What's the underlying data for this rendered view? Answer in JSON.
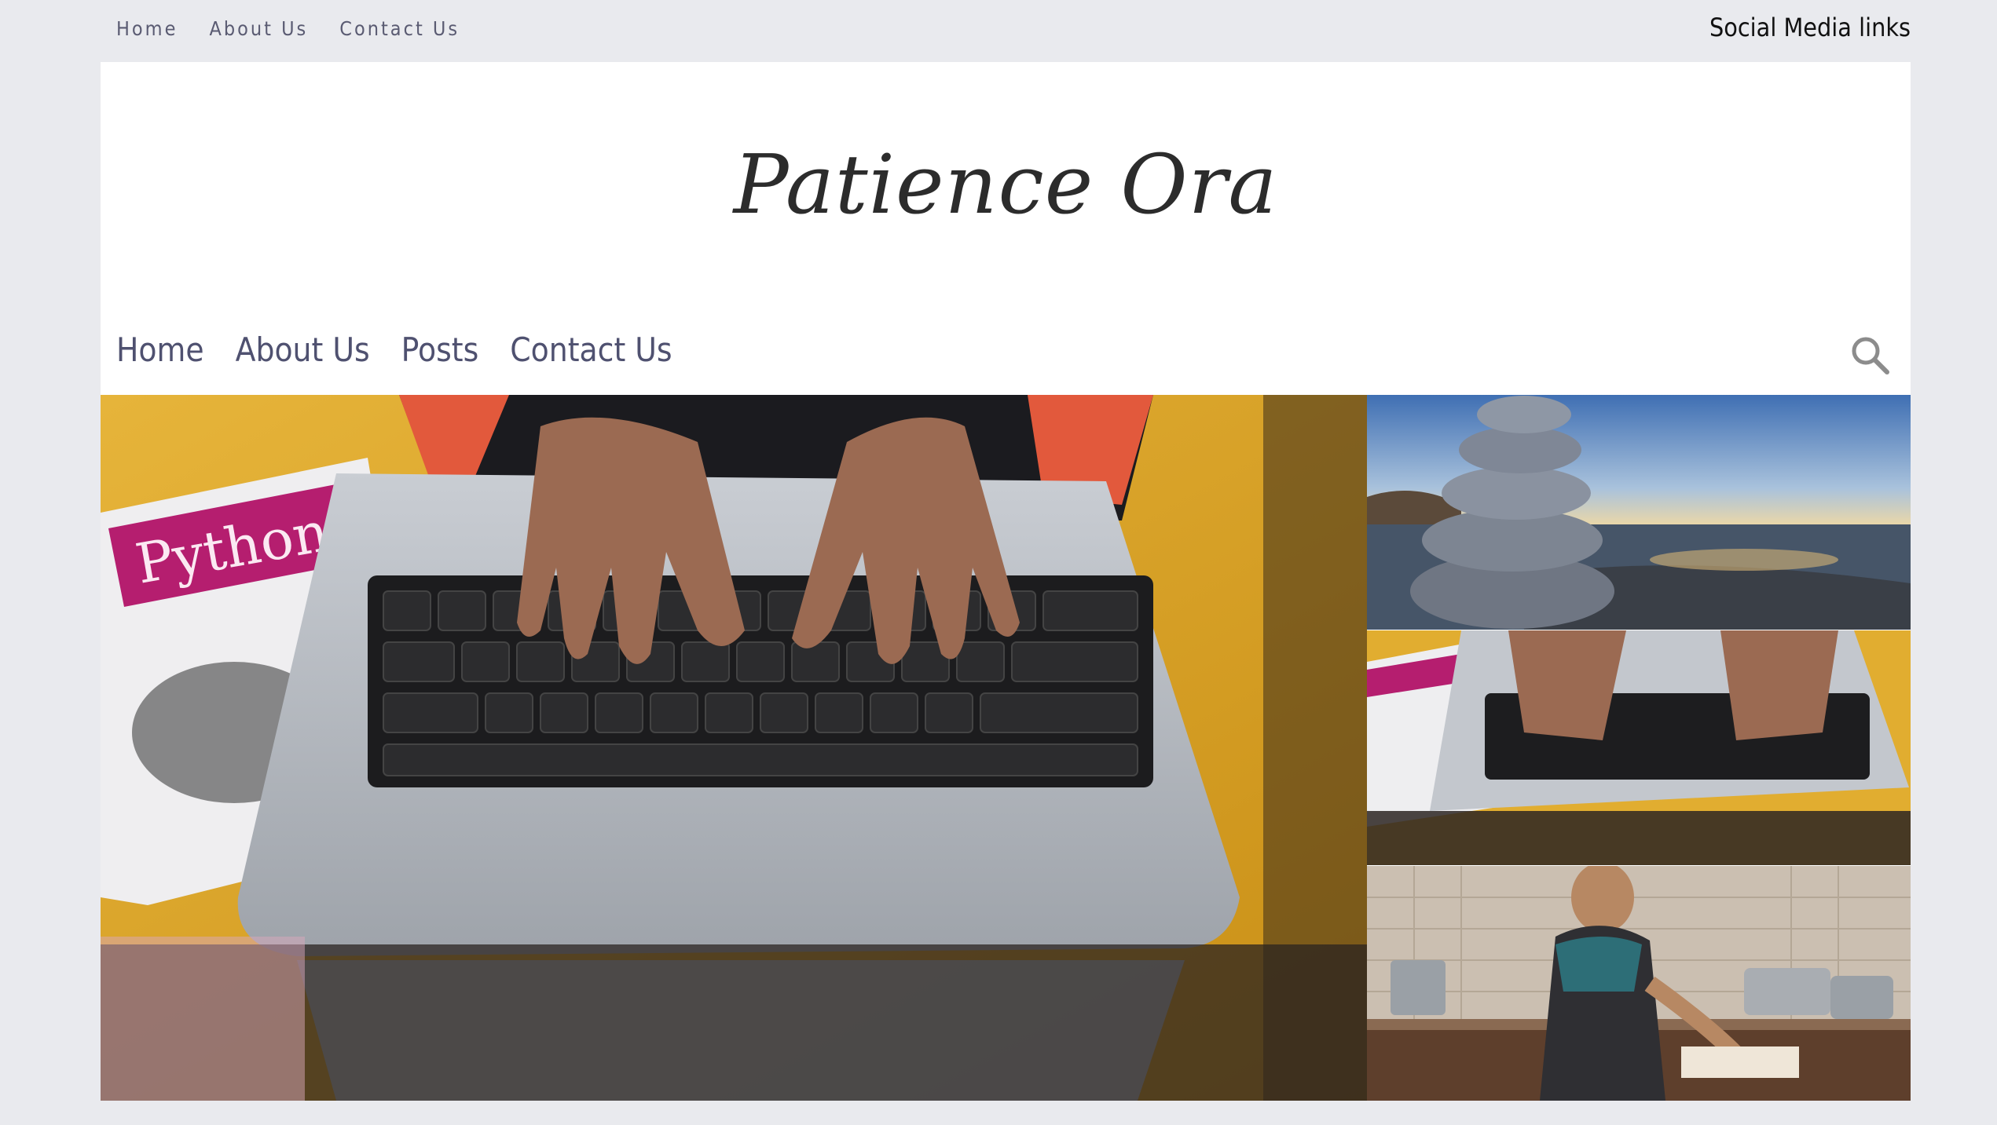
{
  "topnav": {
    "items": [
      {
        "label": "Home"
      },
      {
        "label": "About Us"
      },
      {
        "label": "Contact Us"
      }
    ],
    "social_label": "Social Media links"
  },
  "site": {
    "title": "Patience Ora"
  },
  "mainnav": {
    "items": [
      {
        "label": "Home"
      },
      {
        "label": "About Us"
      },
      {
        "label": "Posts"
      },
      {
        "label": "Contact Us"
      }
    ]
  },
  "icons": {
    "search": "search-icon"
  },
  "colors": {
    "page_bg": "#e9eaee",
    "nav_text": "#4f5170",
    "accent_yellow": "#e8b22e"
  }
}
